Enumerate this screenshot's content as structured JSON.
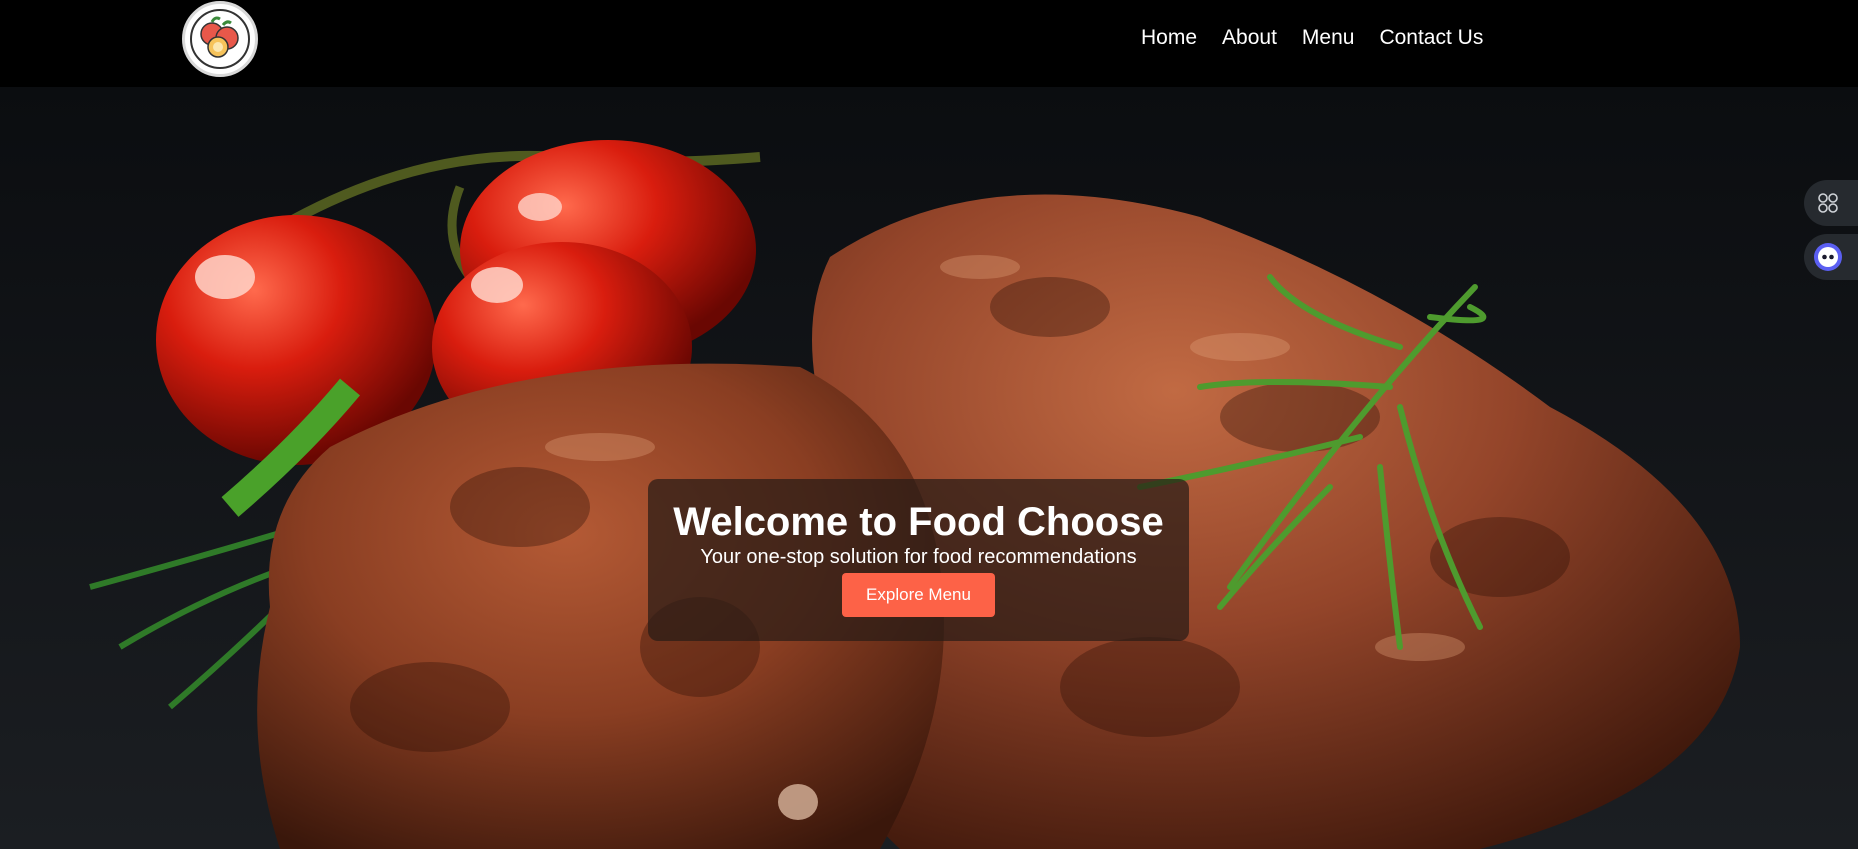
{
  "header": {
    "logo_alt": "Food Choose logo",
    "nav": [
      {
        "label": "Home"
      },
      {
        "label": "About"
      },
      {
        "label": "Menu"
      },
      {
        "label": "Contact Us"
      }
    ]
  },
  "hero": {
    "title": "Welcome to Food Choose",
    "subtitle": "Your one-stop solution for food recommendations",
    "cta_label": "Explore Menu",
    "image": "grilled-steak-with-tomatoes-and-rosemary"
  },
  "side_widgets": [
    {
      "icon": "grid-icon"
    },
    {
      "icon": "assistant-face-icon"
    }
  ],
  "colors": {
    "nav_bg": "#000000",
    "cta_bg": "#fd6247",
    "overlay_bg": "rgba(40,28,22,0.72)"
  }
}
